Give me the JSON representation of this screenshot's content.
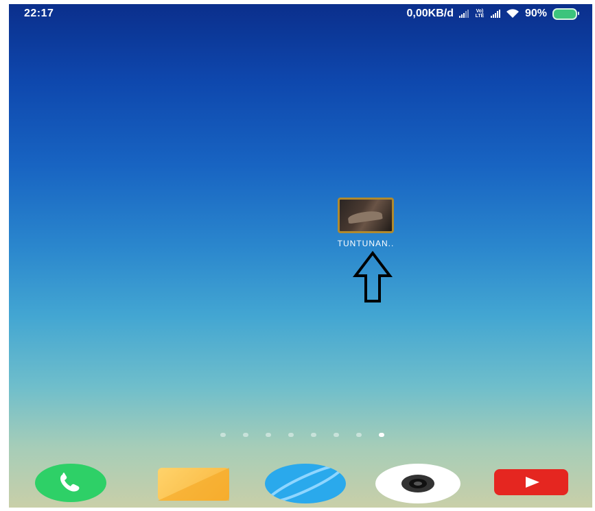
{
  "status_bar": {
    "time": "22:17",
    "net_speed": "0,00KB/d",
    "volte_label": "Vo) LTE",
    "battery": "90%"
  },
  "desktop": {
    "app_label": "TUNTUNAN.."
  },
  "page_indicator": {
    "count": 8,
    "active_index": 7
  },
  "dock": [
    {
      "icon": "phone-icon"
    },
    {
      "icon": "messages-icon"
    },
    {
      "icon": "browser-icon"
    },
    {
      "icon": "camera-icon"
    },
    {
      "icon": "youtube-icon"
    }
  ]
}
